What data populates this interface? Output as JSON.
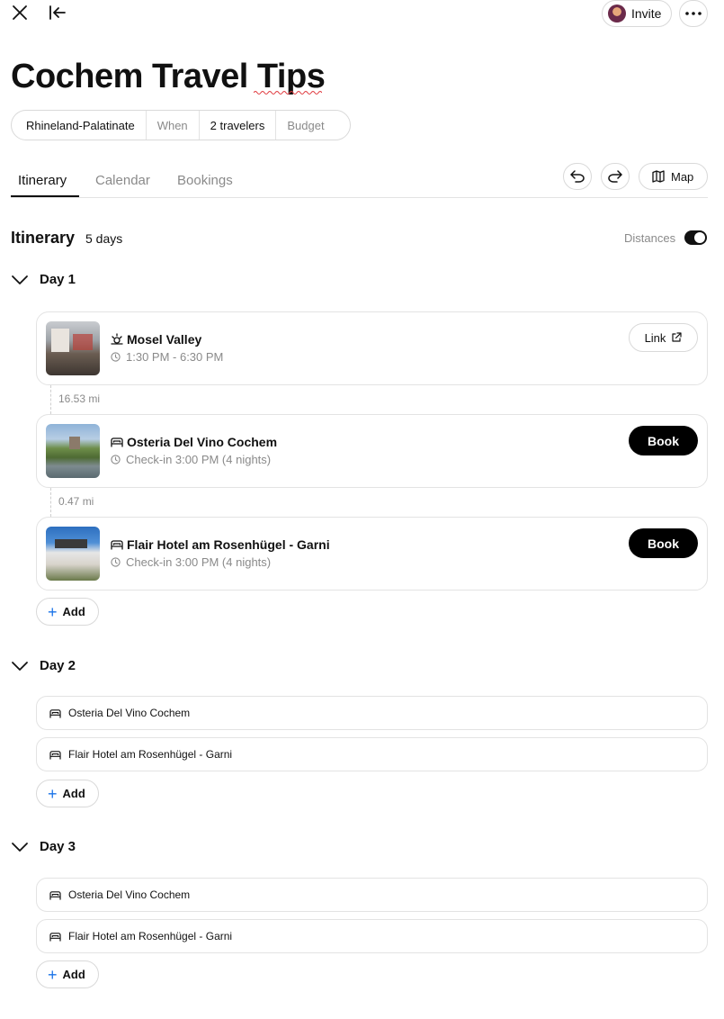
{
  "header": {
    "invite_label": "Invite",
    "title": "Cochem Travel Tips"
  },
  "trip_bar": {
    "location": "Rhineland-Palatinate",
    "when": "When",
    "travelers": "2 travelers",
    "budget": "Budget"
  },
  "tabs": [
    {
      "label": "Itinerary",
      "active": true
    },
    {
      "label": "Calendar",
      "active": false
    },
    {
      "label": "Bookings",
      "active": false
    }
  ],
  "toolbar": {
    "map_label": "Map"
  },
  "itinerary": {
    "heading": "Itinerary",
    "days_count": "5 days",
    "distances_label": "Distances",
    "distances_on": true
  },
  "day1": {
    "label": "Day 1",
    "items": [
      {
        "icon": "sightseeing-icon",
        "title": "Mosel Valley",
        "subtitle": "1:30 PM - 6:30 PM",
        "action": "Link"
      },
      {
        "icon": "bed-icon",
        "title": "Osteria Del Vino Cochem",
        "subtitle": "Check-in 3:00 PM (4 nights)",
        "action": "Book"
      },
      {
        "icon": "bed-icon",
        "title": "Flair Hotel am Rosenhügel - Garni",
        "subtitle": "Check-in 3:00 PM (4 nights)",
        "action": "Book"
      }
    ],
    "distances": [
      "16.53 mi",
      "0.47 mi"
    ],
    "add_label": "Add"
  },
  "day2": {
    "label": "Day 2",
    "items": [
      "Osteria Del Vino Cochem",
      "Flair Hotel am Rosenhügel - Garni"
    ],
    "add_label": "Add"
  },
  "day3": {
    "label": "Day 3",
    "items": [
      "Osteria Del Vino Cochem",
      "Flair Hotel am Rosenhügel - Garni"
    ],
    "add_label": "Add"
  }
}
